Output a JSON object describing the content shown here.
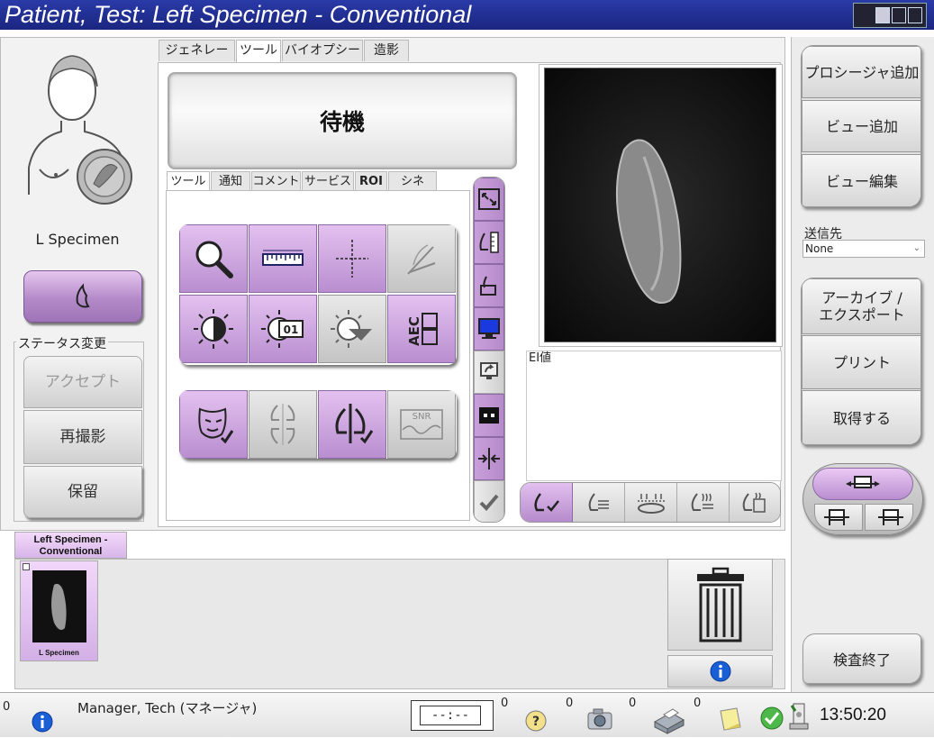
{
  "window": {
    "title": "Patient, Test:  Left Specimen - Conventional"
  },
  "patient": {
    "view_label": "L Specimen"
  },
  "status_change": {
    "legend": "ステータス変更",
    "accept": "アクセプト",
    "retake": "再撮影",
    "hold": "保留"
  },
  "top_tabs": [
    "ジェネレータ",
    "ツール",
    "バイオプシー",
    "造影"
  ],
  "status_display": "待機",
  "tool_tabs": [
    "ツール",
    "通知",
    "コメント",
    "サービス",
    "ROI",
    "シネ"
  ],
  "icons": {
    "aec_text": "AEC",
    "zoom_badge": "01",
    "snr_text": "SNR"
  },
  "ei_label": "EI値",
  "right_panel": {
    "add_procedure": "プロシージャ追加",
    "add_view": "ビュー追加",
    "edit_view": "ビュー編集",
    "send_to_label": "送信先",
    "send_to_value": "None",
    "archive_export": "アーカイブ / エクスポート",
    "print": "プリント",
    "retrieve": "取得する",
    "close_study": "検査終了"
  },
  "series_tab": "Left Specimen - Conventional",
  "thumbnail_label": "L Specimen",
  "status_bar": {
    "count1": "0",
    "user": "Manager, Tech (マネージャ)",
    "timer": "--:--",
    "count2": "0",
    "count3": "0",
    "count4": "0",
    "count5": "0",
    "time": "13:50:20"
  },
  "colors": {
    "title_bg": "#1f2e96",
    "accent_purple": "#b48ac9",
    "ok_green": "#3aa236"
  }
}
